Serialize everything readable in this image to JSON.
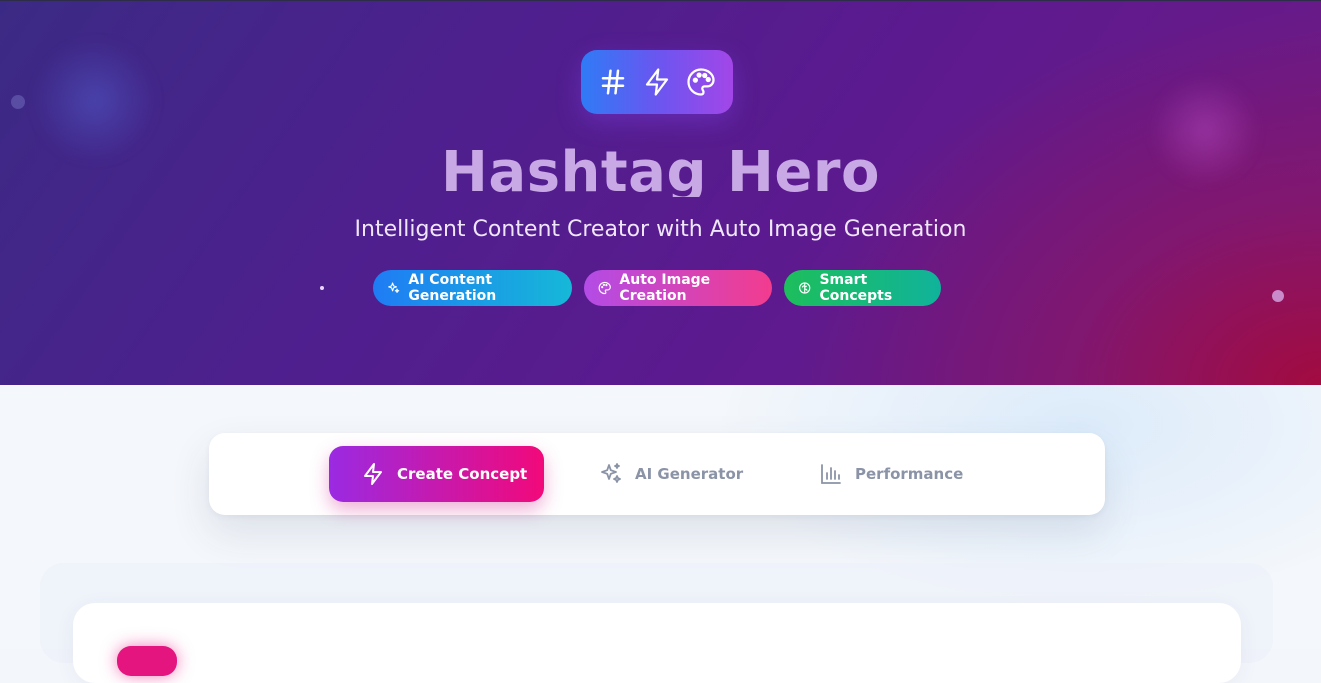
{
  "hero": {
    "title": "Hashtag Hero",
    "subtitle": "Intelligent Content Creator with Auto Image Generation",
    "logo_icons": [
      "hash-icon",
      "bolt-icon",
      "palette-icon"
    ],
    "pills": [
      {
        "label": "AI Content Generation",
        "icon": "sparkles-icon",
        "color": "#1f7cf4"
      },
      {
        "label": "Auto Image Creation",
        "icon": "palette-icon",
        "color": "#f23c8e"
      },
      {
        "label": "Smart Concepts",
        "icon": "brain-icon",
        "color": "#1dbe5c"
      }
    ]
  },
  "tabs": [
    {
      "label": "Create Concept",
      "icon": "bolt-icon",
      "active": true
    },
    {
      "label": "AI Generator",
      "icon": "sparkles-icon",
      "active": false
    },
    {
      "label": "Performance",
      "icon": "bar-chart-icon",
      "active": false
    }
  ],
  "colors": {
    "accent_start": "#9a2ae2",
    "accent_end": "#f2097a",
    "inactive_tab": "#8b93a7",
    "hero_title": "#c9a8e6"
  }
}
